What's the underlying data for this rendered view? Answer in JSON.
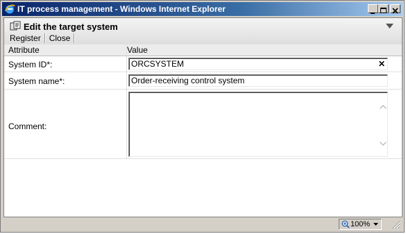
{
  "window": {
    "title": "IT process management - Windows Internet Explorer"
  },
  "header": {
    "title": "Edit the target system"
  },
  "toolbar": {
    "register_label": "Register",
    "close_label": "Close"
  },
  "table": {
    "col_attribute": "Attribute",
    "col_value": "Value"
  },
  "fields": {
    "system_id": {
      "label": "System ID*:",
      "value": "ORCSYSTEM"
    },
    "system_name": {
      "label": "System name*:",
      "value": "Order-receiving control system"
    },
    "comment": {
      "label": "Comment:",
      "value": ""
    }
  },
  "statusbar": {
    "zoom": "100%"
  }
}
